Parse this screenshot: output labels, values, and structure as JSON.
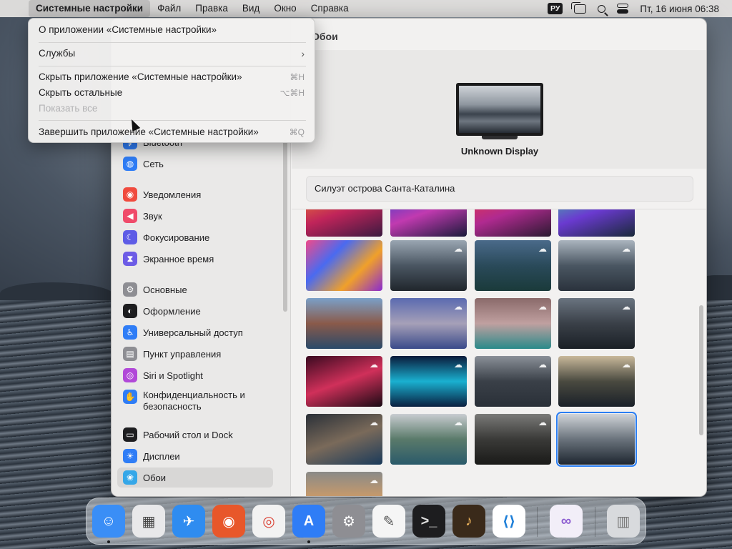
{
  "menubar": {
    "app_name": "Системные настройки",
    "items": [
      "Файл",
      "Правка",
      "Вид",
      "Окно",
      "Справка"
    ],
    "input_source": "РУ",
    "clock": "Пт, 16 июня  06:38"
  },
  "app_menu": {
    "about": "О приложении «Системные настройки»",
    "services": "Службы",
    "hide_app": "Скрыть приложение «Системные настройки»",
    "hide_app_shortcut": "⌘H",
    "hide_others": "Скрыть остальные",
    "hide_others_shortcut": "⌥⌘H",
    "show_all": "Показать все",
    "quit": "Завершить приложение «Системные настройки»",
    "quit_shortcut": "⌘Q"
  },
  "sidebar": {
    "items": [
      {
        "label": "Bluetooth",
        "icon": "bluetooth-icon",
        "color": "#2f7df6"
      },
      {
        "label": "Сеть",
        "icon": "globe-icon",
        "color": "#2f7df6"
      },
      {
        "label": "Уведомления",
        "icon": "bell-icon",
        "color": "#f04b3e"
      },
      {
        "label": "Звук",
        "icon": "speaker-icon",
        "color": "#f04b6a"
      },
      {
        "label": "Фокусирование",
        "icon": "moon-icon",
        "color": "#5e5ce6"
      },
      {
        "label": "Экранное время",
        "icon": "hourglass-icon",
        "color": "#6d5ce6"
      },
      {
        "label": "Основные",
        "icon": "gear-icon",
        "color": "#8e8e93"
      },
      {
        "label": "Оформление",
        "icon": "appearance-icon",
        "color": "#1d1d1f"
      },
      {
        "label": "Универсальный доступ",
        "icon": "accessibility-icon",
        "color": "#2f7df6"
      },
      {
        "label": "Пункт управления",
        "icon": "control-center-icon",
        "color": "#8e8e93"
      },
      {
        "label": "Siri и Spotlight",
        "icon": "siri-icon",
        "color": "#b148d8"
      },
      {
        "label": "Конфиденциальность и\nбезопасность",
        "icon": "hand-icon",
        "color": "#2f7df6"
      },
      {
        "label": "Рабочий стол и Dock",
        "icon": "dock-icon",
        "color": "#1d1d1f"
      },
      {
        "label": "Дисплеи",
        "icon": "sun-icon",
        "color": "#2f7df6"
      },
      {
        "label": "Обои",
        "icon": "wallpaper-icon",
        "color": "#35a7e8"
      }
    ],
    "selected": "Обои"
  },
  "content": {
    "title": "Обои",
    "display_name": "Unknown Display",
    "wallpaper_name": "Силуэт острова Санта-Каталина"
  },
  "dock": {
    "apps": [
      {
        "name": "finder-icon",
        "color": "#3a8ef6"
      },
      {
        "name": "launchpad-icon",
        "color": "#e8e8ea"
      },
      {
        "name": "safari-icon",
        "color": "#2f8cf0"
      },
      {
        "name": "firefox-icon",
        "color": "#e8572a"
      },
      {
        "name": "chrome-icon",
        "color": "#f2f2f2"
      },
      {
        "name": "app-store-icon",
        "color": "#2f7df6"
      },
      {
        "name": "system-settings-icon",
        "color": "#8e8e93"
      },
      {
        "name": "textedit-icon",
        "color": "#f5f5f5"
      },
      {
        "name": "terminal-icon",
        "color": "#1d1d1f"
      },
      {
        "name": "garageband-icon",
        "color": "#3a2a1a"
      },
      {
        "name": "vscode-icon",
        "color": "#ffffff"
      },
      {
        "name": "visual-studio-icon",
        "color": "#f2eef8"
      },
      {
        "name": "trash-icon",
        "color": "#d8dadd"
      }
    ]
  }
}
